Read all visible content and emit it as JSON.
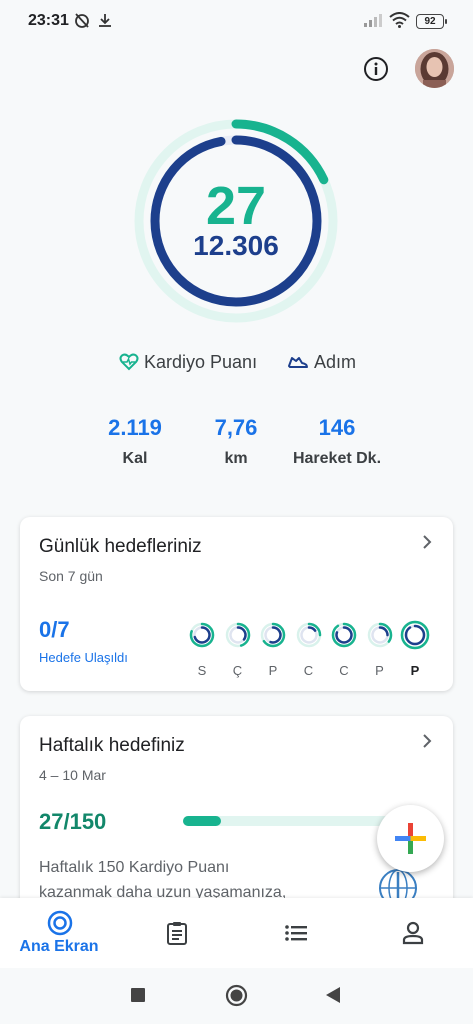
{
  "status_bar": {
    "time": "23:31",
    "battery": "92"
  },
  "summary": {
    "cardio_points": "27",
    "steps": "12.306",
    "legend_cardio": "Kardiyo Puanı",
    "legend_steps": "Adım",
    "cardio_progress": 0.18,
    "steps_progress": 0.97
  },
  "stats": [
    {
      "value": "2.119",
      "label": "Kal"
    },
    {
      "value": "7,76",
      "label": "km"
    },
    {
      "value": "146",
      "label": "Hareket Dk."
    }
  ],
  "daily_goals": {
    "title": "Günlük hedefleriniz",
    "subtitle": "Son 7 gün",
    "count": "0/7",
    "count_label": "Hedefe Ulaşıldı",
    "days": [
      "S",
      "Ç",
      "P",
      "C",
      "C",
      "P",
      "P"
    ]
  },
  "weekly_goal": {
    "title": "Haftalık hedefiniz",
    "subtitle": "4 – 10 Mar",
    "count": "27/150",
    "progress": 0.18,
    "description_line1": "Haftalık 150 Kardiyo Puanı",
    "description_line2": "kazanmak daha uzun yaşamanıza,"
  },
  "nav": {
    "home_label": "Ana Ekran"
  },
  "colors": {
    "cardio": "#18b38f",
    "steps": "#1d3f8c",
    "accent": "#1a73e8"
  },
  "icons": [
    "info-icon",
    "heart-icon",
    "shoe-icon",
    "chevron-right-icon",
    "plus-icon",
    "who-logo-icon",
    "home-ring-icon",
    "journal-icon",
    "list-icon",
    "profile-icon",
    "square-icon",
    "circle-icon",
    "triangle-icon"
  ]
}
